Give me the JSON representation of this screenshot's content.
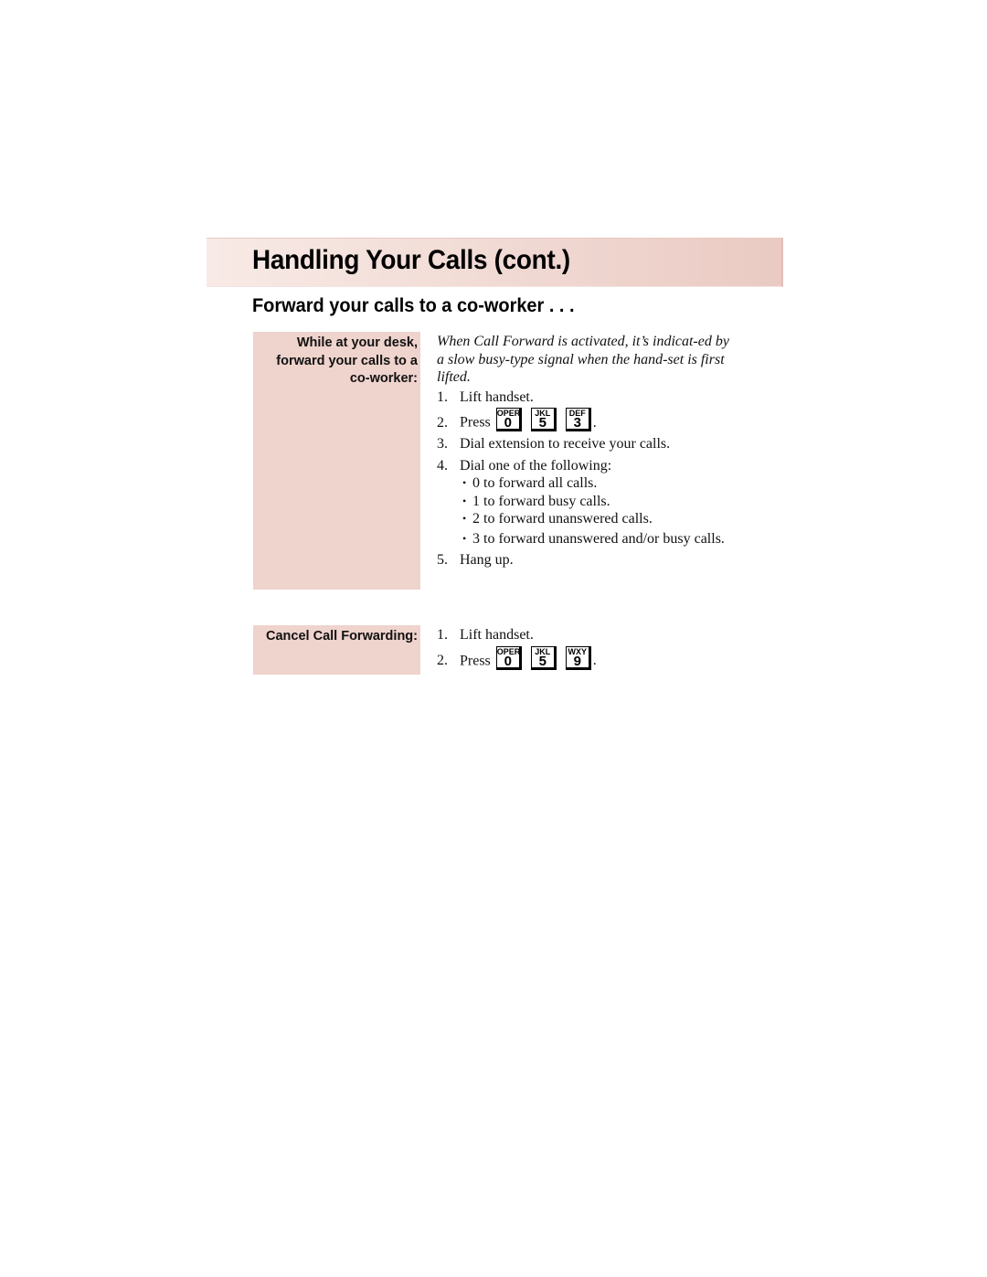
{
  "header": {
    "title": "Handling Your Calls (cont.)"
  },
  "section": {
    "title": "Forward your calls to a co-worker . . ."
  },
  "forward": {
    "sidebar_label": "While at your desk, forward your calls to a co-worker:",
    "intro": "When Call Forward is activated, it’s indicat-ed by a slow busy-type signal when the hand-set is first lifted.",
    "steps": [
      {
        "num": "1.",
        "text": "Lift handset."
      },
      {
        "num": "2.",
        "text": "Press",
        "keys": [
          {
            "letters": "OPER",
            "digit": "0"
          },
          {
            "letters": "JKL",
            "digit": "5"
          },
          {
            "letters": "DEF",
            "digit": "3"
          }
        ],
        "suffix": "."
      },
      {
        "num": "3.",
        "text": "Dial extension to receive your calls."
      },
      {
        "num": "4.",
        "text": "Dial one of the following:"
      },
      {
        "num": "5.",
        "text": "Hang up."
      }
    ],
    "options": [
      "0 to forward all calls.",
      "1 to forward busy calls.",
      "2 to forward unanswered calls.",
      "3 to forward unanswered and/or busy calls."
    ],
    "bullet": "•"
  },
  "cancel": {
    "sidebar_label": "Cancel Call Forwarding:",
    "steps": [
      {
        "num": "1.",
        "text": "Lift handset."
      },
      {
        "num": "2.",
        "text": "Press",
        "keys": [
          {
            "letters": "OPER",
            "digit": "0"
          },
          {
            "letters": "JKL",
            "digit": "5"
          },
          {
            "letters": "WXY",
            "digit": "9"
          }
        ],
        "suffix": "."
      }
    ]
  },
  "colors": {
    "band_light": "#f8eae6",
    "band_dark": "#eacac3",
    "sidebar": "#efd3cd"
  }
}
